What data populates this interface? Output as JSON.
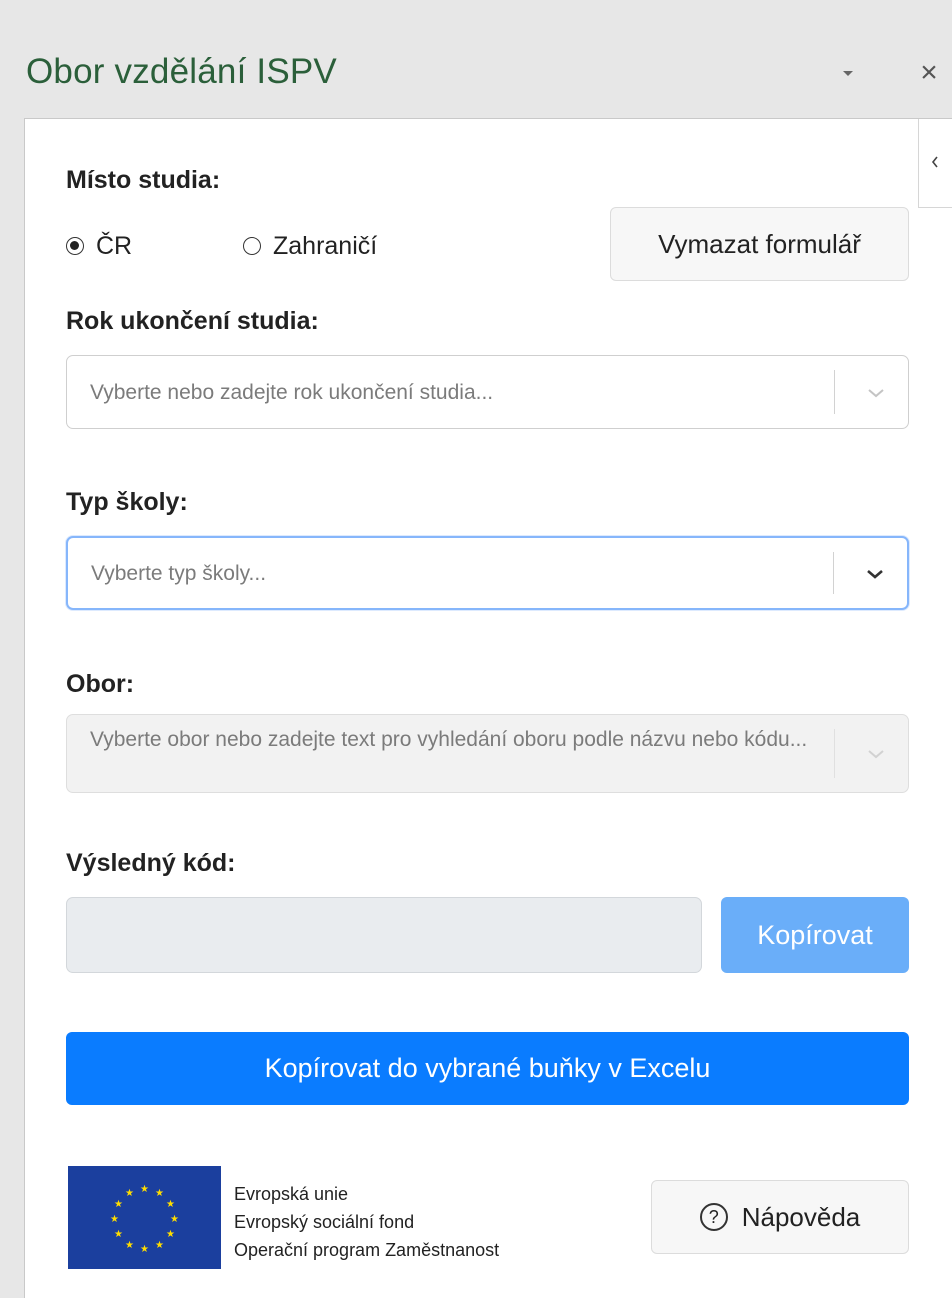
{
  "pane": {
    "title": "Obor vzdělání ISPV",
    "close_symbol": "×",
    "collapse_icon": "chevron-left-icon"
  },
  "form": {
    "place_label": "Místo studia:",
    "radios": [
      {
        "label": "ČR",
        "checked": true
      },
      {
        "label": "Zahraničí",
        "checked": false
      }
    ],
    "clear_button": "Vymazat formulář",
    "year_label": "Rok ukončení studia:",
    "year_placeholder": "Vyberte nebo zadejte rok ukončení studia...",
    "school_type_label": "Typ školy:",
    "school_type_placeholder": "Vyberte typ školy...",
    "field_label": "Obor:",
    "field_placeholder": "Vyberte obor nebo zadejte text pro vyhledání oboru podle názvu nebo kódu...",
    "result_label": "Výsledný kód:",
    "result_value": "",
    "copy_button": "Kopírovat",
    "copy_excel_button": "Kopírovat do vybrané buňky v Excelu"
  },
  "footer": {
    "eu_lines": [
      "Evropská unie",
      "Evropský sociální fond",
      "Operační program Zaměstnanost"
    ],
    "help_icon_symbol": "?",
    "help_button": "Nápověda"
  },
  "colors": {
    "title": "#2b5f3a",
    "primary": "#0a7cff",
    "primary_disabled": "#6aaef9",
    "eu_blue": "#1b3f9e",
    "eu_star": "#ffdd00"
  }
}
